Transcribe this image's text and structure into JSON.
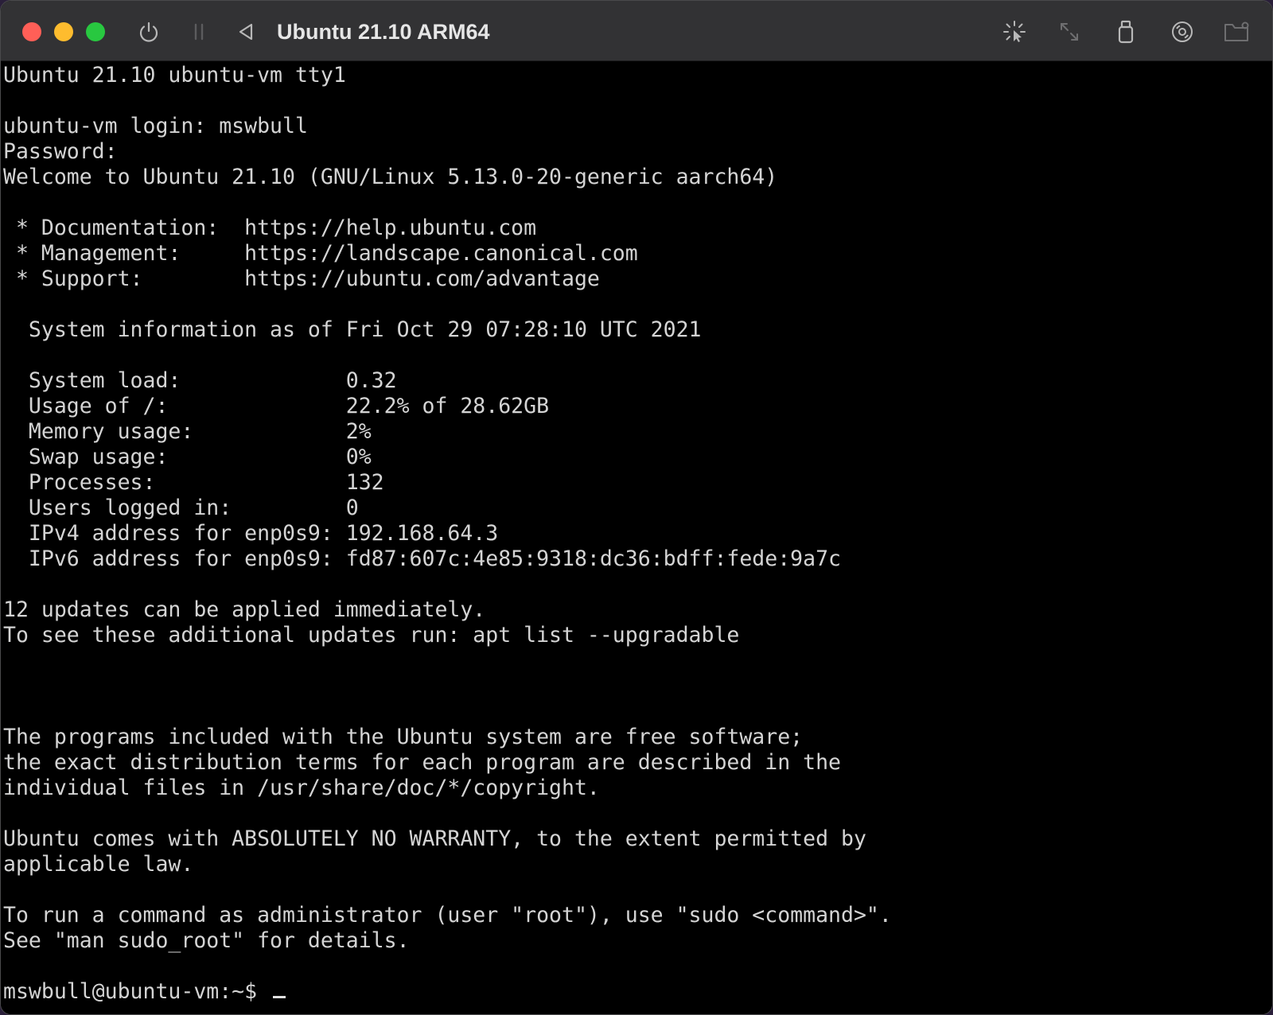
{
  "window": {
    "title": "Ubuntu 21.10 ARM64"
  },
  "toolbar": {
    "left_icons": [
      "power-icon",
      "pause-icon",
      "back-icon"
    ],
    "right_icons": [
      "capture-cursor-icon",
      "resize-icon",
      "usb-icon",
      "disc-icon",
      "shared-folder-icon"
    ]
  },
  "terminal": {
    "lines": [
      "Ubuntu 21.10 ubuntu-vm tty1",
      "",
      "ubuntu-vm login: mswbull",
      "Password:",
      "Welcome to Ubuntu 21.10 (GNU/Linux 5.13.0-20-generic aarch64)",
      "",
      " * Documentation:  https://help.ubuntu.com",
      " * Management:     https://landscape.canonical.com",
      " * Support:        https://ubuntu.com/advantage",
      "",
      "  System information as of Fri Oct 29 07:28:10 UTC 2021",
      "",
      "  System load:             0.32",
      "  Usage of /:              22.2% of 28.62GB",
      "  Memory usage:            2%",
      "  Swap usage:              0%",
      "  Processes:               132",
      "  Users logged in:         0",
      "  IPv4 address for enp0s9: 192.168.64.3",
      "  IPv6 address for enp0s9: fd87:607c:4e85:9318:dc36:bdff:fede:9a7c",
      "",
      "12 updates can be applied immediately.",
      "To see these additional updates run: apt list --upgradable",
      "",
      "",
      "",
      "The programs included with the Ubuntu system are free software;",
      "the exact distribution terms for each program are described in the",
      "individual files in /usr/share/doc/*/copyright.",
      "",
      "Ubuntu comes with ABSOLUTELY NO WARRANTY, to the extent permitted by",
      "applicable law.",
      "",
      "To run a command as administrator (user \"root\"), use \"sudo <command>\".",
      "See \"man sudo_root\" for details.",
      ""
    ],
    "prompt": "mswbull@ubuntu-vm:~$ "
  }
}
